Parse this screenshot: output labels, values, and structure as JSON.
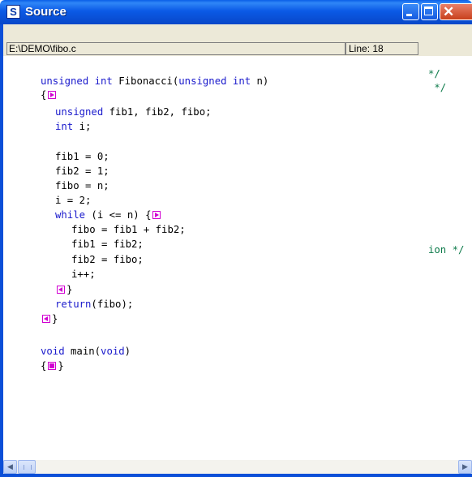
{
  "window": {
    "title": "Source",
    "app_icon_letter": "S",
    "minimize_icon": "minimize-icon",
    "maximize_icon": "maximize-icon",
    "close_icon": "close-icon",
    "close_glyph": "✕"
  },
  "status": {
    "path": "E:\\DEMO\\fibo.c",
    "line": "Line: 18"
  },
  "code": {
    "lines": [
      {
        "k": "",
        "t": "unsigned int Fibonacci(unsigned int n)"
      },
      {
        "k": "",
        "t": "{"
      },
      {
        "k": "",
        "t": "  unsigned fib1, fib2, fibo;"
      },
      {
        "k": "",
        "t": "  int i;"
      },
      {
        "k": "",
        "t": ""
      },
      {
        "k": "",
        "t": "  fib1 = 0;"
      },
      {
        "k": "",
        "t": "  fib2 = 1;"
      },
      {
        "k": "",
        "t": "  fibo = n;"
      },
      {
        "k": "",
        "t": "  i = 2;"
      },
      {
        "k": "",
        "t": "  while (i <= n) {"
      },
      {
        "k": "",
        "t": "    fibo = fib1 + fib2;"
      },
      {
        "k": "",
        "t": "    fib1 = fib2;"
      },
      {
        "k": "",
        "t": "    fib2 = fibo;"
      },
      {
        "k": "",
        "t": "    i++;"
      },
      {
        "k": "",
        "t": "  }"
      },
      {
        "k": "",
        "t": "  return(fibo);"
      },
      {
        "k": "",
        "t": " }"
      },
      {
        "k": "",
        "t": ""
      },
      {
        "k": "",
        "t": "void main(void)"
      },
      {
        "k": "",
        "t": "{ }"
      }
    ],
    "right_comments": [
      "*/",
      " */",
      "ion */"
    ]
  },
  "fold_markers": {
    "collapse_icon": "fold-collapse-icon",
    "expand_icon": "fold-expand-icon",
    "filled_icon": "fold-filled-icon"
  },
  "scrollbar": {
    "left_arrow": "◀",
    "right_arrow": "▶"
  },
  "colors": {
    "keyword": "#1a1acc",
    "comment": "#0d7a4a",
    "fold_marker": "#d100d1",
    "title_bar": "#0b5ae6"
  }
}
